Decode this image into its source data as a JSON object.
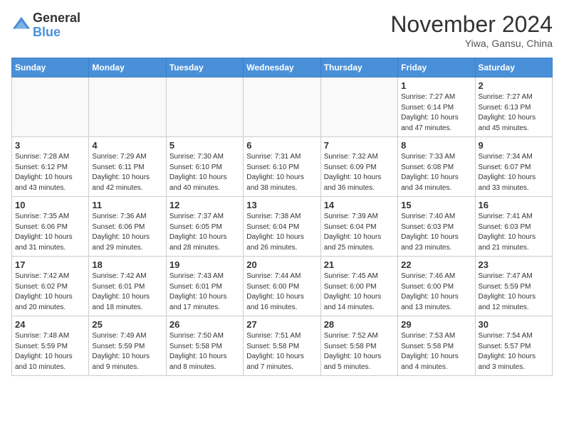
{
  "header": {
    "logo_general": "General",
    "logo_blue": "Blue",
    "month_title": "November 2024",
    "location": "Yiwa, Gansu, China"
  },
  "days_of_week": [
    "Sunday",
    "Monday",
    "Tuesday",
    "Wednesday",
    "Thursday",
    "Friday",
    "Saturday"
  ],
  "weeks": [
    [
      {
        "day": "",
        "empty": true
      },
      {
        "day": "",
        "empty": true
      },
      {
        "day": "",
        "empty": true
      },
      {
        "day": "",
        "empty": true
      },
      {
        "day": "",
        "empty": true
      },
      {
        "day": "1",
        "sunrise": "Sunrise: 7:27 AM",
        "sunset": "Sunset: 6:14 PM",
        "daylight": "Daylight: 10 hours and 47 minutes."
      },
      {
        "day": "2",
        "sunrise": "Sunrise: 7:27 AM",
        "sunset": "Sunset: 6:13 PM",
        "daylight": "Daylight: 10 hours and 45 minutes."
      }
    ],
    [
      {
        "day": "3",
        "sunrise": "Sunrise: 7:28 AM",
        "sunset": "Sunset: 6:12 PM",
        "daylight": "Daylight: 10 hours and 43 minutes."
      },
      {
        "day": "4",
        "sunrise": "Sunrise: 7:29 AM",
        "sunset": "Sunset: 6:11 PM",
        "daylight": "Daylight: 10 hours and 42 minutes."
      },
      {
        "day": "5",
        "sunrise": "Sunrise: 7:30 AM",
        "sunset": "Sunset: 6:10 PM",
        "daylight": "Daylight: 10 hours and 40 minutes."
      },
      {
        "day": "6",
        "sunrise": "Sunrise: 7:31 AM",
        "sunset": "Sunset: 6:10 PM",
        "daylight": "Daylight: 10 hours and 38 minutes."
      },
      {
        "day": "7",
        "sunrise": "Sunrise: 7:32 AM",
        "sunset": "Sunset: 6:09 PM",
        "daylight": "Daylight: 10 hours and 36 minutes."
      },
      {
        "day": "8",
        "sunrise": "Sunrise: 7:33 AM",
        "sunset": "Sunset: 6:08 PM",
        "daylight": "Daylight: 10 hours and 34 minutes."
      },
      {
        "day": "9",
        "sunrise": "Sunrise: 7:34 AM",
        "sunset": "Sunset: 6:07 PM",
        "daylight": "Daylight: 10 hours and 33 minutes."
      }
    ],
    [
      {
        "day": "10",
        "sunrise": "Sunrise: 7:35 AM",
        "sunset": "Sunset: 6:06 PM",
        "daylight": "Daylight: 10 hours and 31 minutes."
      },
      {
        "day": "11",
        "sunrise": "Sunrise: 7:36 AM",
        "sunset": "Sunset: 6:06 PM",
        "daylight": "Daylight: 10 hours and 29 minutes."
      },
      {
        "day": "12",
        "sunrise": "Sunrise: 7:37 AM",
        "sunset": "Sunset: 6:05 PM",
        "daylight": "Daylight: 10 hours and 28 minutes."
      },
      {
        "day": "13",
        "sunrise": "Sunrise: 7:38 AM",
        "sunset": "Sunset: 6:04 PM",
        "daylight": "Daylight: 10 hours and 26 minutes."
      },
      {
        "day": "14",
        "sunrise": "Sunrise: 7:39 AM",
        "sunset": "Sunset: 6:04 PM",
        "daylight": "Daylight: 10 hours and 25 minutes."
      },
      {
        "day": "15",
        "sunrise": "Sunrise: 7:40 AM",
        "sunset": "Sunset: 6:03 PM",
        "daylight": "Daylight: 10 hours and 23 minutes."
      },
      {
        "day": "16",
        "sunrise": "Sunrise: 7:41 AM",
        "sunset": "Sunset: 6:03 PM",
        "daylight": "Daylight: 10 hours and 21 minutes."
      }
    ],
    [
      {
        "day": "17",
        "sunrise": "Sunrise: 7:42 AM",
        "sunset": "Sunset: 6:02 PM",
        "daylight": "Daylight: 10 hours and 20 minutes."
      },
      {
        "day": "18",
        "sunrise": "Sunrise: 7:42 AM",
        "sunset": "Sunset: 6:01 PM",
        "daylight": "Daylight: 10 hours and 18 minutes."
      },
      {
        "day": "19",
        "sunrise": "Sunrise: 7:43 AM",
        "sunset": "Sunset: 6:01 PM",
        "daylight": "Daylight: 10 hours and 17 minutes."
      },
      {
        "day": "20",
        "sunrise": "Sunrise: 7:44 AM",
        "sunset": "Sunset: 6:00 PM",
        "daylight": "Daylight: 10 hours and 16 minutes."
      },
      {
        "day": "21",
        "sunrise": "Sunrise: 7:45 AM",
        "sunset": "Sunset: 6:00 PM",
        "daylight": "Daylight: 10 hours and 14 minutes."
      },
      {
        "day": "22",
        "sunrise": "Sunrise: 7:46 AM",
        "sunset": "Sunset: 6:00 PM",
        "daylight": "Daylight: 10 hours and 13 minutes."
      },
      {
        "day": "23",
        "sunrise": "Sunrise: 7:47 AM",
        "sunset": "Sunset: 5:59 PM",
        "daylight": "Daylight: 10 hours and 12 minutes."
      }
    ],
    [
      {
        "day": "24",
        "sunrise": "Sunrise: 7:48 AM",
        "sunset": "Sunset: 5:59 PM",
        "daylight": "Daylight: 10 hours and 10 minutes."
      },
      {
        "day": "25",
        "sunrise": "Sunrise: 7:49 AM",
        "sunset": "Sunset: 5:59 PM",
        "daylight": "Daylight: 10 hours and 9 minutes."
      },
      {
        "day": "26",
        "sunrise": "Sunrise: 7:50 AM",
        "sunset": "Sunset: 5:58 PM",
        "daylight": "Daylight: 10 hours and 8 minutes."
      },
      {
        "day": "27",
        "sunrise": "Sunrise: 7:51 AM",
        "sunset": "Sunset: 5:58 PM",
        "daylight": "Daylight: 10 hours and 7 minutes."
      },
      {
        "day": "28",
        "sunrise": "Sunrise: 7:52 AM",
        "sunset": "Sunset: 5:58 PM",
        "daylight": "Daylight: 10 hours and 5 minutes."
      },
      {
        "day": "29",
        "sunrise": "Sunrise: 7:53 AM",
        "sunset": "Sunset: 5:58 PM",
        "daylight": "Daylight: 10 hours and 4 minutes."
      },
      {
        "day": "30",
        "sunrise": "Sunrise: 7:54 AM",
        "sunset": "Sunset: 5:57 PM",
        "daylight": "Daylight: 10 hours and 3 minutes."
      }
    ]
  ]
}
